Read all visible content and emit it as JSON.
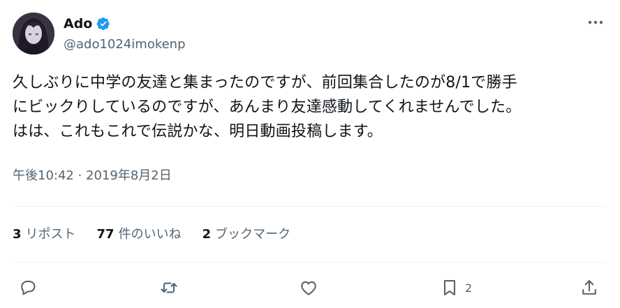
{
  "user": {
    "display_name": "Ado",
    "handle": "@ado1024imokenp"
  },
  "tweet": {
    "text": "久しぶりに中学の友達と集まったのですが、前回集合したのが8/1で勝手\nにビックりしているのですが、あんまり友達感動してくれませんでした。\nはは、これもこれで伝説かな、明日動画投稿します。",
    "timestamp": "午後10:42 · 2019年8月2日"
  },
  "stats": {
    "reposts": {
      "count": "3",
      "label": "リポスト"
    },
    "likes": {
      "count": "77",
      "label": "件のいいね"
    },
    "bookmarks": {
      "count": "2",
      "label": "ブックマーク"
    }
  },
  "actions": {
    "bookmark_count": "2"
  },
  "icons": [
    "verified-badge-icon",
    "more-options-icon",
    "reply-icon",
    "repost-icon",
    "like-icon",
    "bookmark-icon",
    "share-icon"
  ],
  "colors": {
    "text": "#0f1419",
    "secondary_text": "#536471",
    "verified_blue": "#1d9bf0",
    "divider": "#eff3f4"
  }
}
